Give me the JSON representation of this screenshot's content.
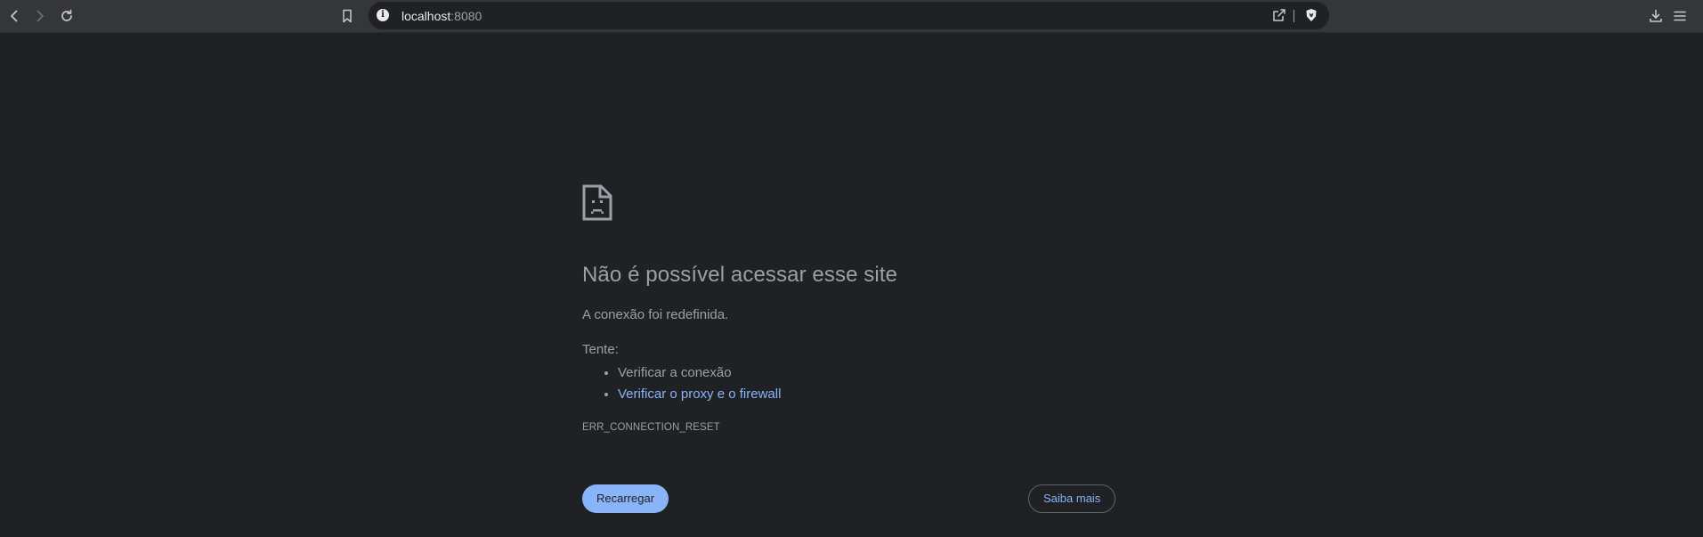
{
  "browser": {
    "url_host": "localhost",
    "url_port": ":8080",
    "icons": {
      "back": "arrow-left-icon",
      "forward": "arrow-right-icon",
      "reload": "reload-icon",
      "bookmark": "bookmark-icon",
      "site_info": "info-icon",
      "share": "share-icon",
      "brave": "brave-shield-icon",
      "downloads": "download-icon",
      "menu": "hamburger-menu-icon"
    }
  },
  "error_page": {
    "icon": "sad-page-icon",
    "title": "Não é possível acessar esse site",
    "description": "A conexão foi redefinida.",
    "try_label": "Tente:",
    "suggestions": [
      {
        "text": "Verificar a conexão",
        "is_link": false
      },
      {
        "text": "Verificar o proxy e o firewall",
        "is_link": true
      }
    ],
    "error_code": "ERR_CONNECTION_RESET",
    "reload_button": "Recarregar",
    "learn_more_button": "Saiba mais"
  },
  "colors": {
    "background": "#202124",
    "toolbar": "#35363a",
    "text": "#9aa0a6",
    "link": "#8ab4f8",
    "primary_button": "#8ab4f8"
  }
}
